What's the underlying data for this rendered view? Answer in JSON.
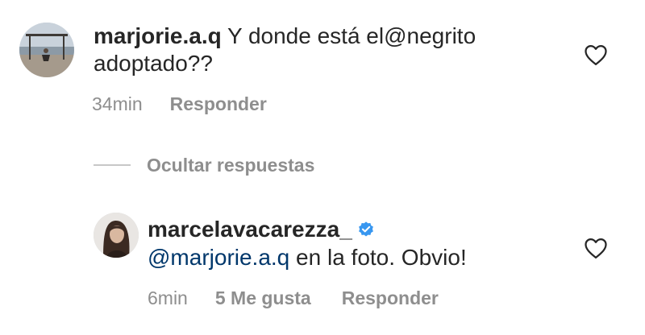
{
  "comment": {
    "username": "marjorie.a.q",
    "text_before": "Y donde está el",
    "mention": "@negrito",
    "text_after": "adoptado??",
    "time": "34min",
    "reply_label": "Responder"
  },
  "replies_toggle": {
    "label": "Ocultar respuestas"
  },
  "reply": {
    "username": "marcelavacarezza_",
    "mention": "@marjorie.a.q",
    "text": " en la foto. Obvio!",
    "time": "6min",
    "likes_label": "5 Me gusta",
    "reply_label": "Responder"
  },
  "icons": {
    "like": "heart-outline-icon",
    "verified": "verified-badge-icon"
  },
  "colors": {
    "text": "#262626",
    "muted": "#8e8e8e",
    "mention": "#00376b",
    "verified": "#3897f0"
  }
}
